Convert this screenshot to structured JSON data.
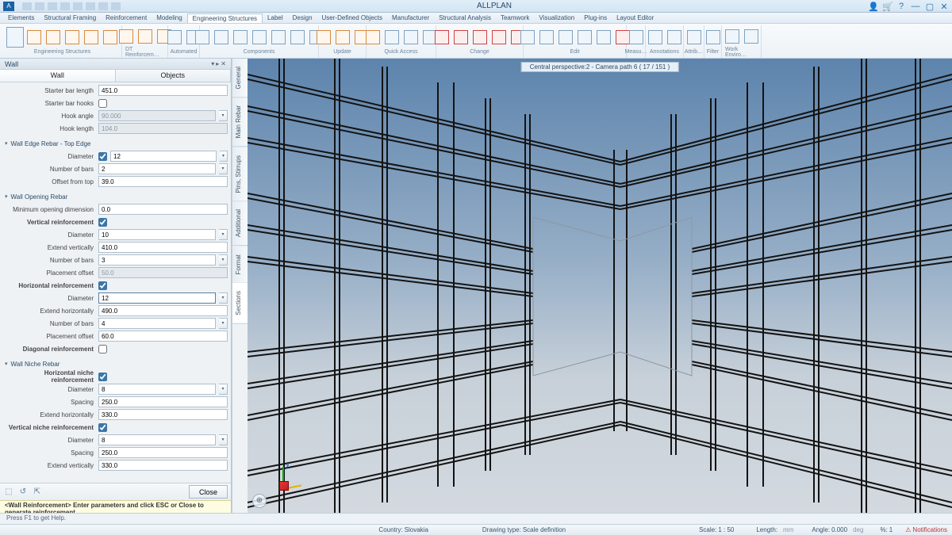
{
  "app": {
    "title": "ALLPLAN"
  },
  "ribbon_tabs": [
    "Elements",
    "Structural Framing",
    "Reinforcement",
    "Modeling",
    "Engineering Structures",
    "Label",
    "Design",
    "User-Defined Objects",
    "Manufacturer",
    "Structural Analysis",
    "Teamwork",
    "Visualization",
    "Plug-ins",
    "Layout Editor"
  ],
  "ribbon_active": "Engineering Structures",
  "ribbon_groups": [
    "Engineering Structures",
    "DT Reinforcem…",
    "Automated",
    "Components",
    "Update",
    "Quick Access",
    "Change",
    "Edit",
    "Measu…",
    "Annotations",
    "Attrib…",
    "Filter",
    "Work Enviro…"
  ],
  "palette": {
    "title": "Wall",
    "tabs": [
      "Wall",
      "Objects"
    ],
    "active_tab": "Wall"
  },
  "side_tabs": [
    "General",
    "Main Rebar",
    "Pins, Stirrups",
    "Additional",
    "Format",
    "Sections"
  ],
  "side_active": "Sections",
  "props": {
    "starter_bar_length_l": "Starter bar length",
    "starter_bar_length": "451.0",
    "starter_bar_hooks_l": "Starter bar hooks",
    "hook_angle_l": "Hook angle",
    "hook_angle": "90.000",
    "hook_length_l": "Hook length",
    "hook_length": "104.0",
    "sec_top_edge": "Wall Edge Rebar - Top Edge",
    "te_diameter_l": "Diameter",
    "te_diameter": "12",
    "te_nbars_l": "Number of bars",
    "te_nbars": "2",
    "te_offset_l": "Offset from top",
    "te_offset": "39.0",
    "sec_opening": "Wall Opening Rebar",
    "op_min_l": "Minimum opening dimension",
    "op_min": "0.0",
    "op_v_l": "Vertical reinforcement",
    "op_v_dia_l": "Diameter",
    "op_v_dia": "10",
    "op_v_ext_l": "Extend vertically",
    "op_v_ext": "410.0",
    "op_v_nbars_l": "Number of bars",
    "op_v_nbars": "3",
    "op_v_poff_l": "Placement offset",
    "op_v_poff": "50.0",
    "op_h_l": "Horizontal reinforcement",
    "op_h_dia_l": "Diameter",
    "op_h_dia": "12",
    "op_h_ext_l": "Extend horizontally",
    "op_h_ext": "490.0",
    "op_h_nbars_l": "Number of bars",
    "op_h_nbars": "4",
    "op_h_poff_l": "Placement offset",
    "op_h_poff": "60.0",
    "op_d_l": "Diagonal reinforcement",
    "sec_niche": "Wall Niche Rebar",
    "ni_h_l": "Horizontal niche reinforcement",
    "ni_h_dia_l": "Diameter",
    "ni_h_dia": "8",
    "ni_h_sp_l": "Spacing",
    "ni_h_sp": "250.0",
    "ni_h_ext_l": "Extend horizontally",
    "ni_h_ext": "330.0",
    "ni_v_l": "Vertical niche reinforcement",
    "ni_v_dia_l": "Diameter",
    "ni_v_dia": "8",
    "ni_v_sp_l": "Spacing",
    "ni_v_sp": "250.0",
    "ni_v_ext_l": "Extend vertically",
    "ni_v_ext": "330.0"
  },
  "footer": {
    "close": "Close"
  },
  "info_bar": {
    "label": "<Wall Reinforcement>",
    "text": "Enter parameters and click ESC or Close to generate reinforcement"
  },
  "viewport": {
    "label": "Central perspective:2 - Camera path 6 ( 17 / 151 )"
  },
  "status": {
    "help": "Press F1 to get Help.",
    "country_l": "Country:",
    "country": "Slovakia",
    "dtype_l": "Drawing type:",
    "dtype": "Scale definition",
    "scale_l": "Scale:",
    "scale": "1 : 50",
    "length_l": "Length:",
    "length": "mm",
    "angle_l": "Angle:",
    "angle": "0.000",
    "angle_u": "deg",
    "pct_l": "%:",
    "pct": "1",
    "notif": "Notifications"
  }
}
